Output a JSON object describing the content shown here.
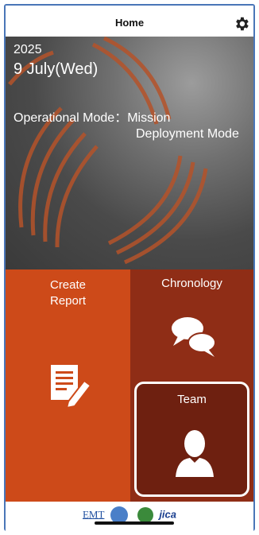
{
  "header": {
    "title": "Home",
    "settings_icon": "gear-icon"
  },
  "hero": {
    "year": "2025",
    "date": "9 July(Wed)",
    "mode_line1": "Operational Mode：Mission",
    "mode_line2": "Deployment Mode"
  },
  "tiles": {
    "create_report": {
      "label_line1": "Create",
      "label_line2": "Report",
      "icon": "report-edit-icon"
    },
    "chronology": {
      "label": "Chronology",
      "icon": "chat-bubbles-icon"
    },
    "team": {
      "label": "Team",
      "icon": "person-icon"
    }
  },
  "footer": {
    "logos": [
      "EMT",
      "WHO",
      "globe",
      "jica"
    ],
    "emt_text": "EMT",
    "jica_text": "jica"
  },
  "colors": {
    "create_tile": "#cd4a19",
    "dark_tile": "#8f2d16",
    "frame": "#4a76b8"
  }
}
